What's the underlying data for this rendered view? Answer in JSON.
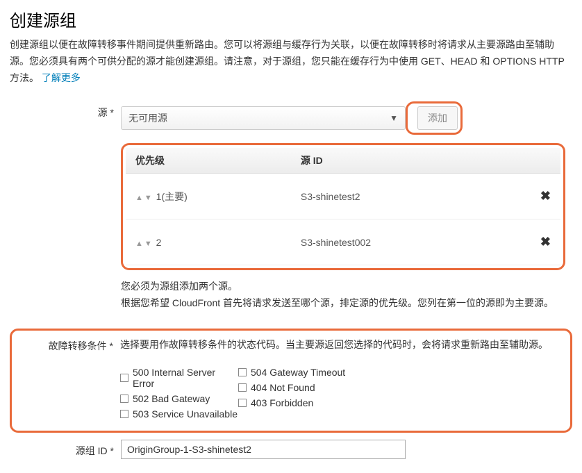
{
  "title": "创建源组",
  "description_part1": "创建源组以便在故障转移事件期间提供重新路由。您可以将源组与缓存行为关联，以便在故障转移时将请求从主要源路由至辅助源。您必须具有两个可供分配的源才能创建源组。请注意，对于源组，您只能在缓存行为中使用 GET、HEAD 和 OPTIONS HTTP 方法。",
  "learn_more": "了解更多",
  "origins_label": "源 *",
  "origins_select_value": "无可用源",
  "add_button": "添加",
  "table_headers": {
    "priority": "优先级",
    "origin_id": "源 ID"
  },
  "table_rows": [
    {
      "priority": "1(主要)",
      "origin_id": "S3-shinetest2"
    },
    {
      "priority": "2",
      "origin_id": "S3-shinetest002"
    }
  ],
  "hint_line1": "您必须为源组添加两个源。",
  "hint_line2": "根据您希望 CloudFront 首先将请求发送至哪个源，排定源的优先级。您列在第一位的源即为主要源。",
  "failover_label": "故障转移条件 *",
  "failover_desc": "选择要用作故障转移条件的状态代码。当主要源返回您选择的代码时，会将请求重新路由至辅助源。",
  "failover_codes_col1": [
    "500 Internal Server Error",
    "502 Bad Gateway",
    "503 Service Unavailable"
  ],
  "failover_codes_col2": [
    "504 Gateway Timeout",
    "404 Not Found",
    "403 Forbidden"
  ],
  "group_id_label": "源组 ID *",
  "group_id_value": "OriginGroup-1-S3-shinetest2"
}
